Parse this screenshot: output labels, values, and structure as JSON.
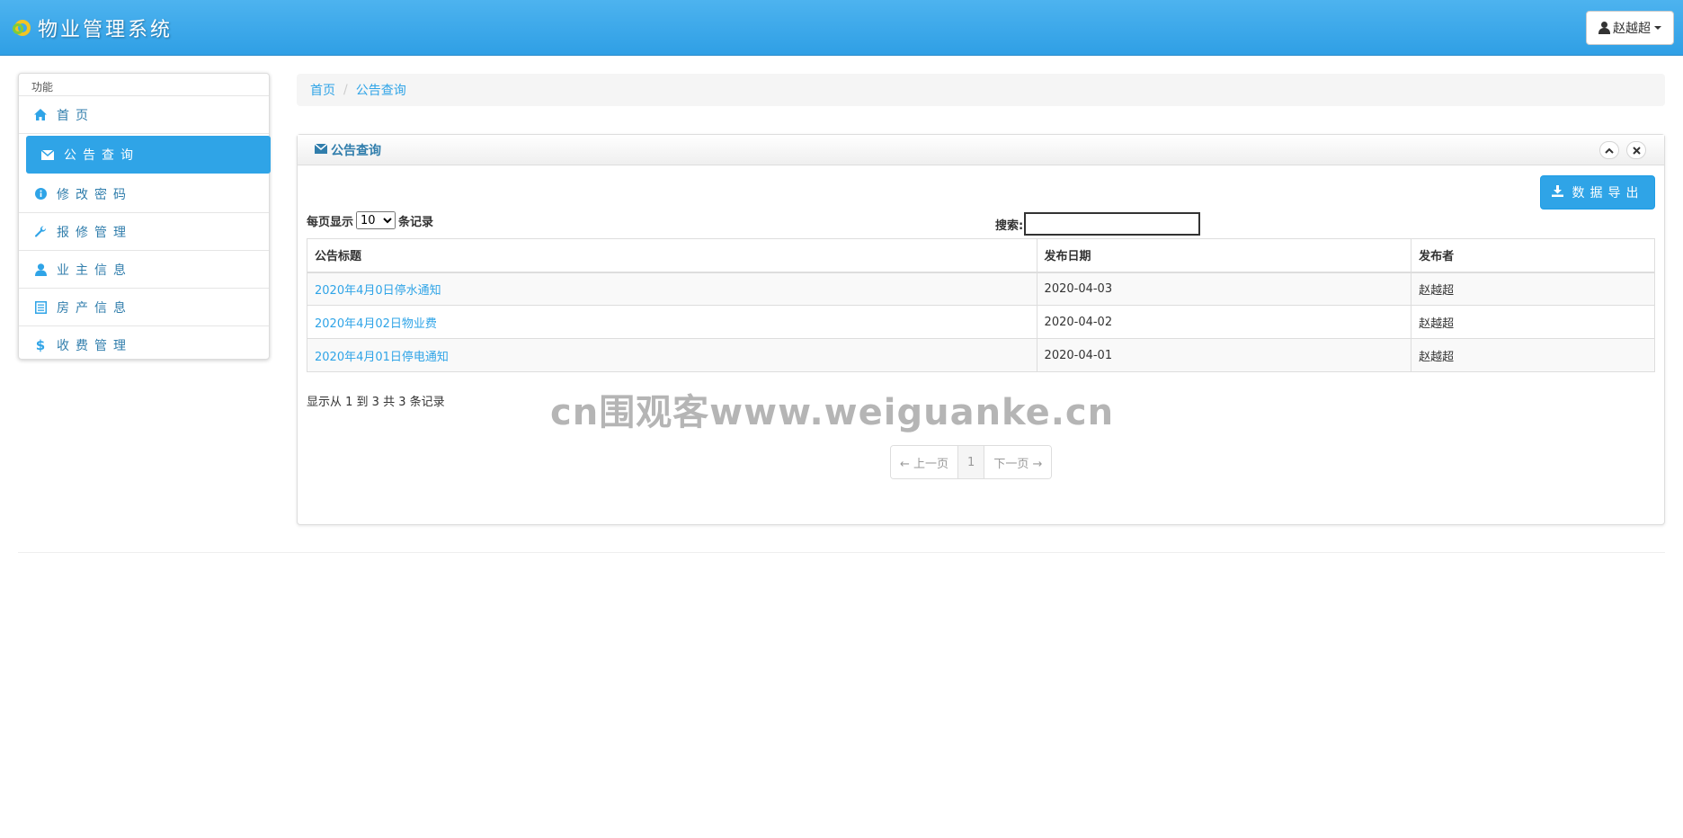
{
  "app": {
    "title": "物业管理系统"
  },
  "user": {
    "name": "赵越超"
  },
  "sidebar": {
    "header": "功能",
    "items": [
      {
        "label": "首页",
        "icon": "home-icon",
        "active": false
      },
      {
        "label": "公告查询",
        "icon": "envelope-icon",
        "active": true
      },
      {
        "label": "修改密码",
        "icon": "info-icon",
        "active": false
      },
      {
        "label": "报修管理",
        "icon": "wrench-icon",
        "active": false
      },
      {
        "label": "业主信息",
        "icon": "user-icon",
        "active": false
      },
      {
        "label": "房产信息",
        "icon": "list-icon",
        "active": false
      },
      {
        "label": "收费管理",
        "icon": "dollar-icon",
        "active": false
      }
    ]
  },
  "breadcrumb": {
    "home": "首页",
    "current": "公告查询"
  },
  "panel": {
    "title": "公告查询",
    "export_label": "数据导出",
    "length_prefix": "每页显示",
    "length_value": "10",
    "length_suffix": "条记录",
    "search_label": "搜索:",
    "search_value": "",
    "columns": [
      "公告标题",
      "发布日期",
      "发布者"
    ],
    "rows": [
      {
        "title": "2020年4月0日停水通知",
        "date": "2020-04-03",
        "author": "赵越超"
      },
      {
        "title": "2020年4月02日物业费",
        "date": "2020-04-02",
        "author": "赵越超"
      },
      {
        "title": "2020年4月01日停电通知",
        "date": "2020-04-01",
        "author": "赵越超"
      }
    ],
    "info": "显示从 1 到 3 共 3 条记录",
    "pager": {
      "prev": "← 上一页",
      "current": "1",
      "next": "下一页 →"
    }
  },
  "watermark": "cn围观客www.weiguanke.cn",
  "colors": {
    "accent": "#2fa4e7",
    "header": "#3aa8eb"
  }
}
